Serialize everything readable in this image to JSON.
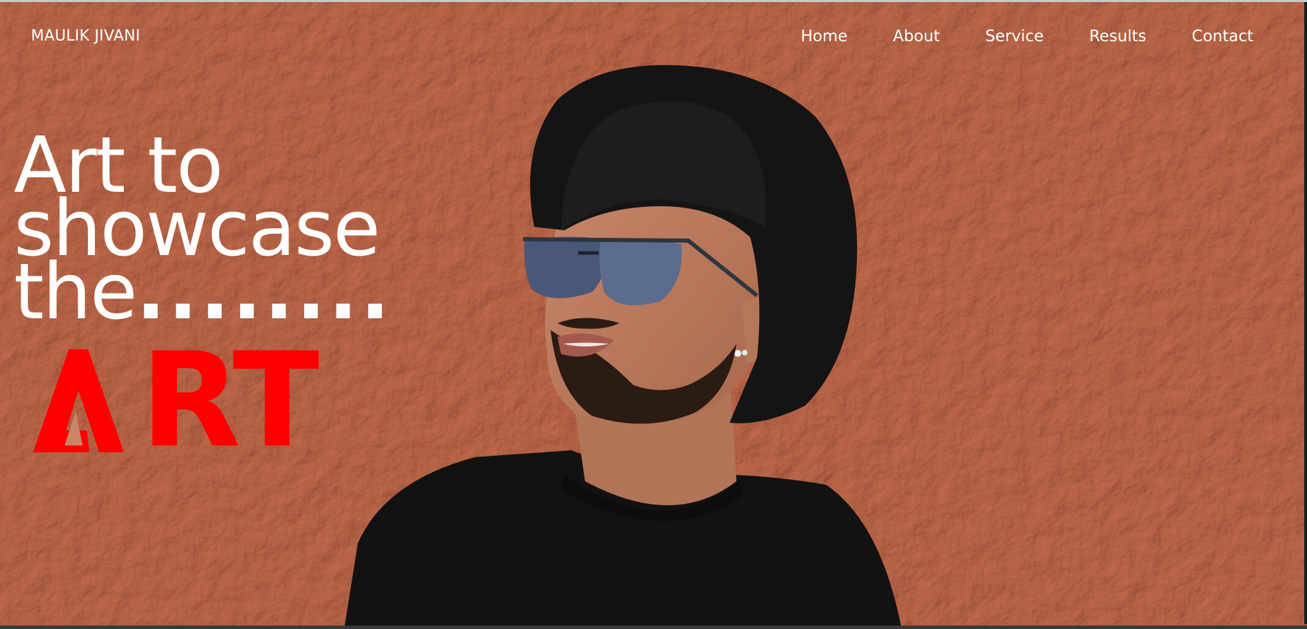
{
  "brand": {
    "name": "MAULIK JIVANI"
  },
  "nav": {
    "items": [
      {
        "label": "Home"
      },
      {
        "label": "About"
      },
      {
        "label": "Service"
      },
      {
        "label": "Results"
      },
      {
        "label": "Contact"
      }
    ]
  },
  "hero": {
    "line1": "Art to",
    "line2": "showcase",
    "line3": "the",
    "dots": "........",
    "art_rest": "RT"
  },
  "colors": {
    "wall": "#c98566",
    "accent": "#ff0000",
    "text": "#ffffff"
  }
}
